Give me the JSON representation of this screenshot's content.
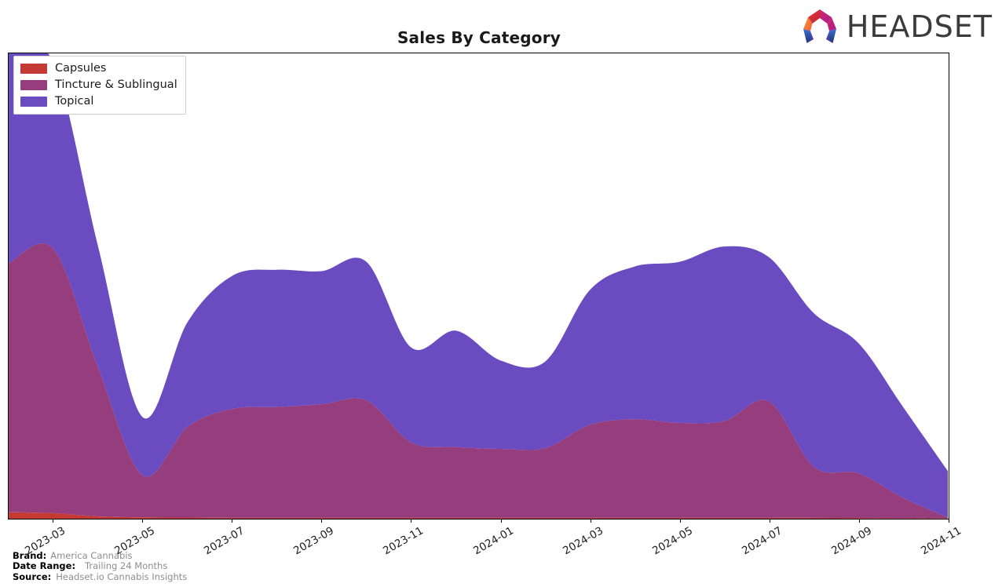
{
  "header": {
    "title": "Sales By Category",
    "logo_text": "HEADSET",
    "logo_icon": "headset-hexagon-logo"
  },
  "legend": {
    "position": "upper-left",
    "items": [
      {
        "label": "Capsules",
        "color": "#c43a35"
      },
      {
        "label": "Tincture & Sublingual",
        "color": "#963d7e"
      },
      {
        "label": "Topical",
        "color": "#6a4bc0"
      }
    ]
  },
  "footer": {
    "rows": [
      {
        "key": "Brand:",
        "value": "America Cannabis"
      },
      {
        "key": "Date Range:",
        "value": "Trailing 24 Months"
      },
      {
        "key": "Source:",
        "value": "Headset.io Cannabis Insights"
      }
    ]
  },
  "chart_data": {
    "type": "area",
    "stacked": true,
    "title": "Sales By Category",
    "xlabel": "",
    "ylabel": "",
    "grid": false,
    "legend_position": "upper-left",
    "axis": {
      "y_visible_ticks": false,
      "x_tick_rotation": -30,
      "xlim": [
        "2023-02",
        "2024-11"
      ],
      "ylim": [
        0,
        100
      ]
    },
    "x": [
      "2023-02",
      "2023-03",
      "2023-04",
      "2023-05",
      "2023-06",
      "2023-07",
      "2023-08",
      "2023-09",
      "2023-10",
      "2023-11",
      "2023-12",
      "2024-01",
      "2024-02",
      "2024-03",
      "2024-04",
      "2024-05",
      "2024-06",
      "2024-07",
      "2024-08",
      "2024-09",
      "2024-10",
      "2024-11"
    ],
    "xtick_labels": [
      "2023-03",
      "2023-05",
      "2023-07",
      "2023-09",
      "2023-11",
      "2024-01",
      "2024-03",
      "2024-05",
      "2024-07",
      "2024-09",
      "2024-11"
    ],
    "series": [
      {
        "name": "Capsules",
        "color": "#c43a35",
        "values": [
          1.4,
          1.2,
          0.5,
          0.3,
          0.25,
          0.2,
          0.2,
          0.2,
          0.2,
          0.2,
          0.2,
          0.2,
          0.2,
          0.2,
          0.2,
          0.2,
          0.2,
          0.2,
          0.2,
          0.15,
          0.1,
          0.05
        ]
      },
      {
        "name": "Tincture & Sublingual",
        "color": "#963d7e",
        "values": [
          53.5,
          56.8,
          32.0,
          9.0,
          19.5,
          23.4,
          23.8,
          24.4,
          25.2,
          16.2,
          15.2,
          14.8,
          15.0,
          20.0,
          21.2,
          20.4,
          20.8,
          25.0,
          11.0,
          9.6,
          4.4,
          0.2
        ]
      },
      {
        "name": "Topical",
        "color": "#6a4bc0",
        "values": [
          46.4,
          40.0,
          26.0,
          12.5,
          22.5,
          28.6,
          29.5,
          28.6,
          29.8,
          20.4,
          25.0,
          19.0,
          18.6,
          29.0,
          32.8,
          34.6,
          37.5,
          31.0,
          33.0,
          28.0,
          19.5,
          10.0
        ]
      }
    ]
  }
}
